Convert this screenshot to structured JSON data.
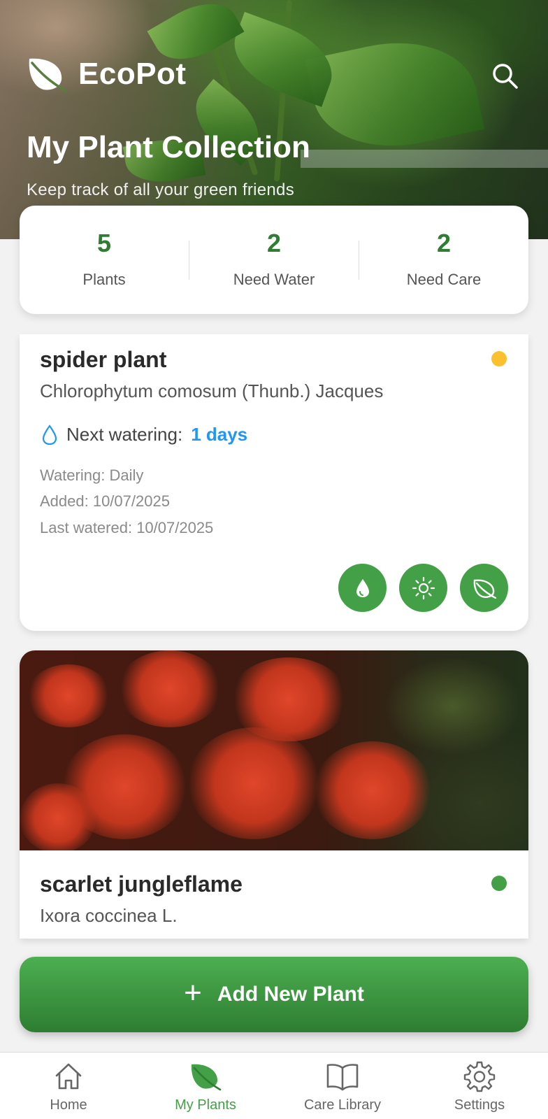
{
  "app": {
    "name": "EcoPot",
    "accent_color": "#43a047",
    "icons": {
      "logo": "leaf-icon",
      "search": "search-icon"
    }
  },
  "hero": {
    "title": "My Plant Collection",
    "subtitle": "Keep track of all your green friends"
  },
  "stats": [
    {
      "value": "5",
      "label": "Plants"
    },
    {
      "value": "2",
      "label": "Need Water"
    },
    {
      "value": "2",
      "label": "Need Care"
    }
  ],
  "plants": [
    {
      "name": "spider plant",
      "scientific_name": "Chlorophytum comosum (Thunb.) Jacques",
      "status_color": "#fbc02d",
      "next_watering_label": "Next watering:",
      "next_watering_value": "1 days",
      "watering": "Watering: Daily",
      "added": "Added: 10/07/2025",
      "last_watered": "Last watered: 10/07/2025",
      "actions": [
        "water-drop-icon",
        "sun-icon",
        "leaf-icon"
      ]
    },
    {
      "name": "scarlet jungleflame",
      "scientific_name": "Ixora coccinea L.",
      "status_color": "#43a047"
    }
  ],
  "add_button": {
    "label": "Add New Plant",
    "icon": "plus-icon"
  },
  "bottom_nav": [
    {
      "label": "Home",
      "icon": "home-icon",
      "active": false
    },
    {
      "label": "My Plants",
      "icon": "leaf-icon",
      "active": true
    },
    {
      "label": "Care Library",
      "icon": "book-icon",
      "active": false
    },
    {
      "label": "Settings",
      "icon": "gear-icon",
      "active": false
    }
  ]
}
